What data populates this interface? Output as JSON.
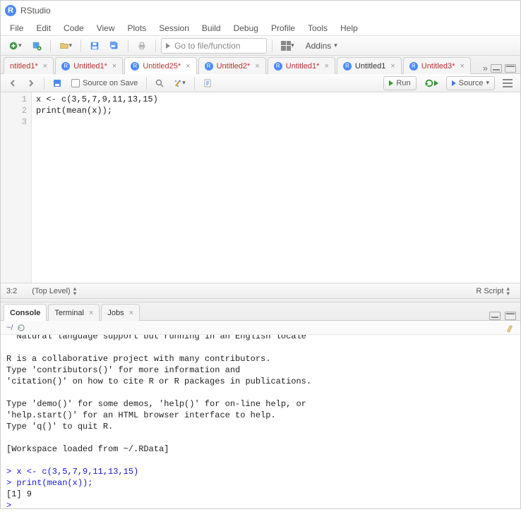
{
  "app": {
    "title": "RStudio",
    "logo_letter": "R"
  },
  "menu": [
    "File",
    "Edit",
    "Code",
    "View",
    "Plots",
    "Session",
    "Build",
    "Debug",
    "Profile",
    "Tools",
    "Help"
  ],
  "toolbar": {
    "goto_placeholder": "Go to file/function",
    "addins_label": "Addins"
  },
  "editor_tabs": [
    {
      "name": "ntitled1*",
      "dirty": true,
      "active": false,
      "show_icon": false
    },
    {
      "name": "Untitled1*",
      "dirty": true,
      "active": false,
      "show_icon": true
    },
    {
      "name": "Untitled25*",
      "dirty": true,
      "active": true,
      "show_icon": true
    },
    {
      "name": "Untitled2*",
      "dirty": true,
      "active": false,
      "show_icon": true
    },
    {
      "name": "Untitled1*",
      "dirty": true,
      "active": false,
      "show_icon": true
    },
    {
      "name": "Untitled1",
      "dirty": false,
      "active": false,
      "show_icon": true
    },
    {
      "name": "Untitled3*",
      "dirty": true,
      "active": false,
      "show_icon": true
    }
  ],
  "editor_toolbar": {
    "source_on_save": "Source on Save",
    "run": "Run",
    "source": "Source"
  },
  "code_lines": [
    "x <- c(3,5,7,9,11,13,15)",
    "print(mean(x));",
    ""
  ],
  "status": {
    "cursor": "3:2",
    "scope": "(Top Level)",
    "lang": "R Script"
  },
  "bottom_tabs": [
    {
      "name": "Console",
      "active": true,
      "closeable": false
    },
    {
      "name": "Terminal",
      "active": false,
      "closeable": true
    },
    {
      "name": "Jobs",
      "active": false,
      "closeable": true
    }
  ],
  "console": {
    "path": "~/",
    "lines": [
      {
        "t": "  Natural language support but running in an English locale",
        "c": ""
      },
      {
        "t": "",
        "c": ""
      },
      {
        "t": "R is a collaborative project with many contributors.",
        "c": ""
      },
      {
        "t": "Type 'contributors()' for more information and",
        "c": ""
      },
      {
        "t": "'citation()' on how to cite R or R packages in publications.",
        "c": ""
      },
      {
        "t": "",
        "c": ""
      },
      {
        "t": "Type 'demo()' for some demos, 'help()' for on-line help, or",
        "c": ""
      },
      {
        "t": "'help.start()' for an HTML browser interface to help.",
        "c": ""
      },
      {
        "t": "Type 'q()' to quit R.",
        "c": ""
      },
      {
        "t": "",
        "c": ""
      },
      {
        "t": "[Workspace loaded from ~/.RData]",
        "c": ""
      },
      {
        "t": "",
        "c": ""
      },
      {
        "t": "> x <- c(3,5,7,9,11,13,15)",
        "c": "blue"
      },
      {
        "t": "> print(mean(x));",
        "c": "blue"
      },
      {
        "t": "[1] 9",
        "c": ""
      },
      {
        "t": "> ",
        "c": "blue"
      }
    ]
  }
}
